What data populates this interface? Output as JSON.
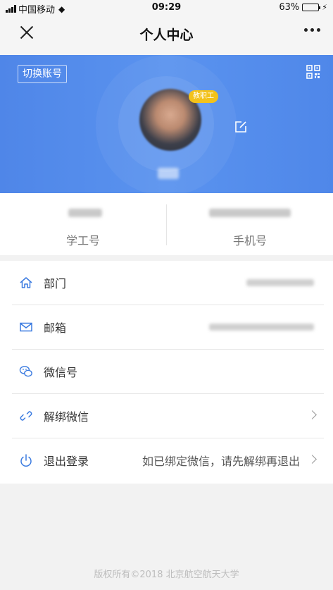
{
  "status_bar": {
    "carrier": "中国移动",
    "time": "09:29",
    "battery": "63%",
    "battery_level": 0.63
  },
  "nav": {
    "title": "个人中心",
    "close_icon": "close-icon",
    "more_icon": "more-dots-icon"
  },
  "profile": {
    "switch_account": "切换账号",
    "role_badge": "教职工",
    "qr_icon": "qr-code-icon",
    "edit_icon": "edit-icon"
  },
  "stats": [
    {
      "label": "学工号"
    },
    {
      "label": "手机号"
    }
  ],
  "list": {
    "department": {
      "label": "部门",
      "icon": "home-icon"
    },
    "email": {
      "label": "邮箱",
      "icon": "mail-icon"
    },
    "wechat_id": {
      "label": "微信号",
      "icon": "wechat-icon"
    },
    "unbind_wechat": {
      "label": "解绑微信",
      "icon": "link-icon"
    },
    "logout": {
      "label": "退出登录",
      "icon": "power-icon",
      "note": "如已绑定微信，请先解绑再退出"
    }
  },
  "footer": "版权所有©2018 北京航空航天大学",
  "colors": {
    "banner": "#5a93ef",
    "badge": "#f3c21b",
    "icon_blue": "#3b7be0"
  }
}
